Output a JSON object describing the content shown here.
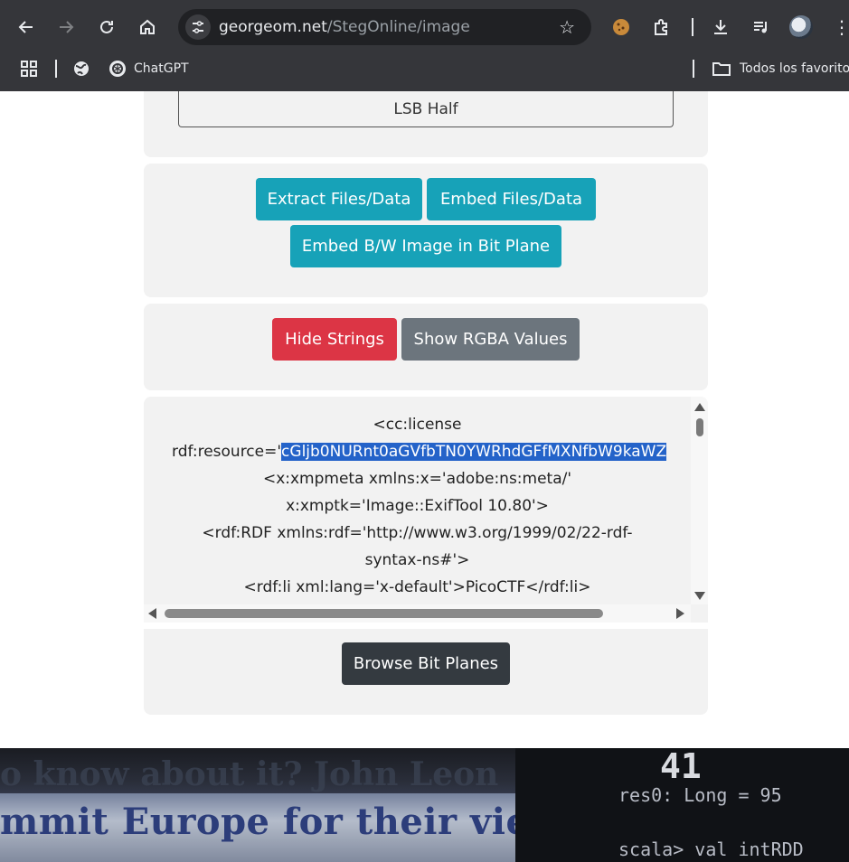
{
  "browser": {
    "url_domain": "georgeom.net",
    "url_path": "/StegOnline/image",
    "bookmarks": {
      "chatgpt": "ChatGPT",
      "all_bookmarks": "Todos los favoritos"
    }
  },
  "page": {
    "select_value": "LSB Half",
    "extract_button": "Extract Files/Data",
    "embed_button": "Embed Files/Data",
    "embed_bw_button": "Embed B/W Image in Bit Plane",
    "hide_strings_button": "Hide Strings",
    "show_rgba_button": "Show RGBA Values",
    "browse_bit_planes_button": "Browse Bit Planes",
    "strings": {
      "line1": "<cc:license",
      "line2_prefix": "rdf:resource='",
      "line2_selected": "cGljb0NURnt0aGVfbTN0YWRhdGFfMXNfbW9kaWZ",
      "line3": "<x:xmpmeta xmlns:x='adobe:ns:meta/'",
      "line4": "x:xmptk='Image::ExifTool 10.80'>",
      "line5": "<rdf:RDF xmlns:rdf='http://www.w3.org/1999/02/22-rdf-",
      "line6": "syntax-ns#'>",
      "line7": "<rdf:li xml:lang='x-default'>PicoCTF</rdf:li>"
    }
  },
  "video": {
    "caption_top": "o know about it? John Leon",
    "caption": "mmit Europe for their views",
    "terminal_number": "41",
    "terminal_line1": "res0: Long = 95",
    "terminal_line2": "scala> val intRDD"
  },
  "colors": {
    "chrome_bg": "#35363a",
    "panel_bg": "#f2f2f2",
    "info": "#17a2b8",
    "danger": "#dc3545",
    "secondary": "#6c757d",
    "dark": "#343a40",
    "selection": "#2463c9"
  }
}
